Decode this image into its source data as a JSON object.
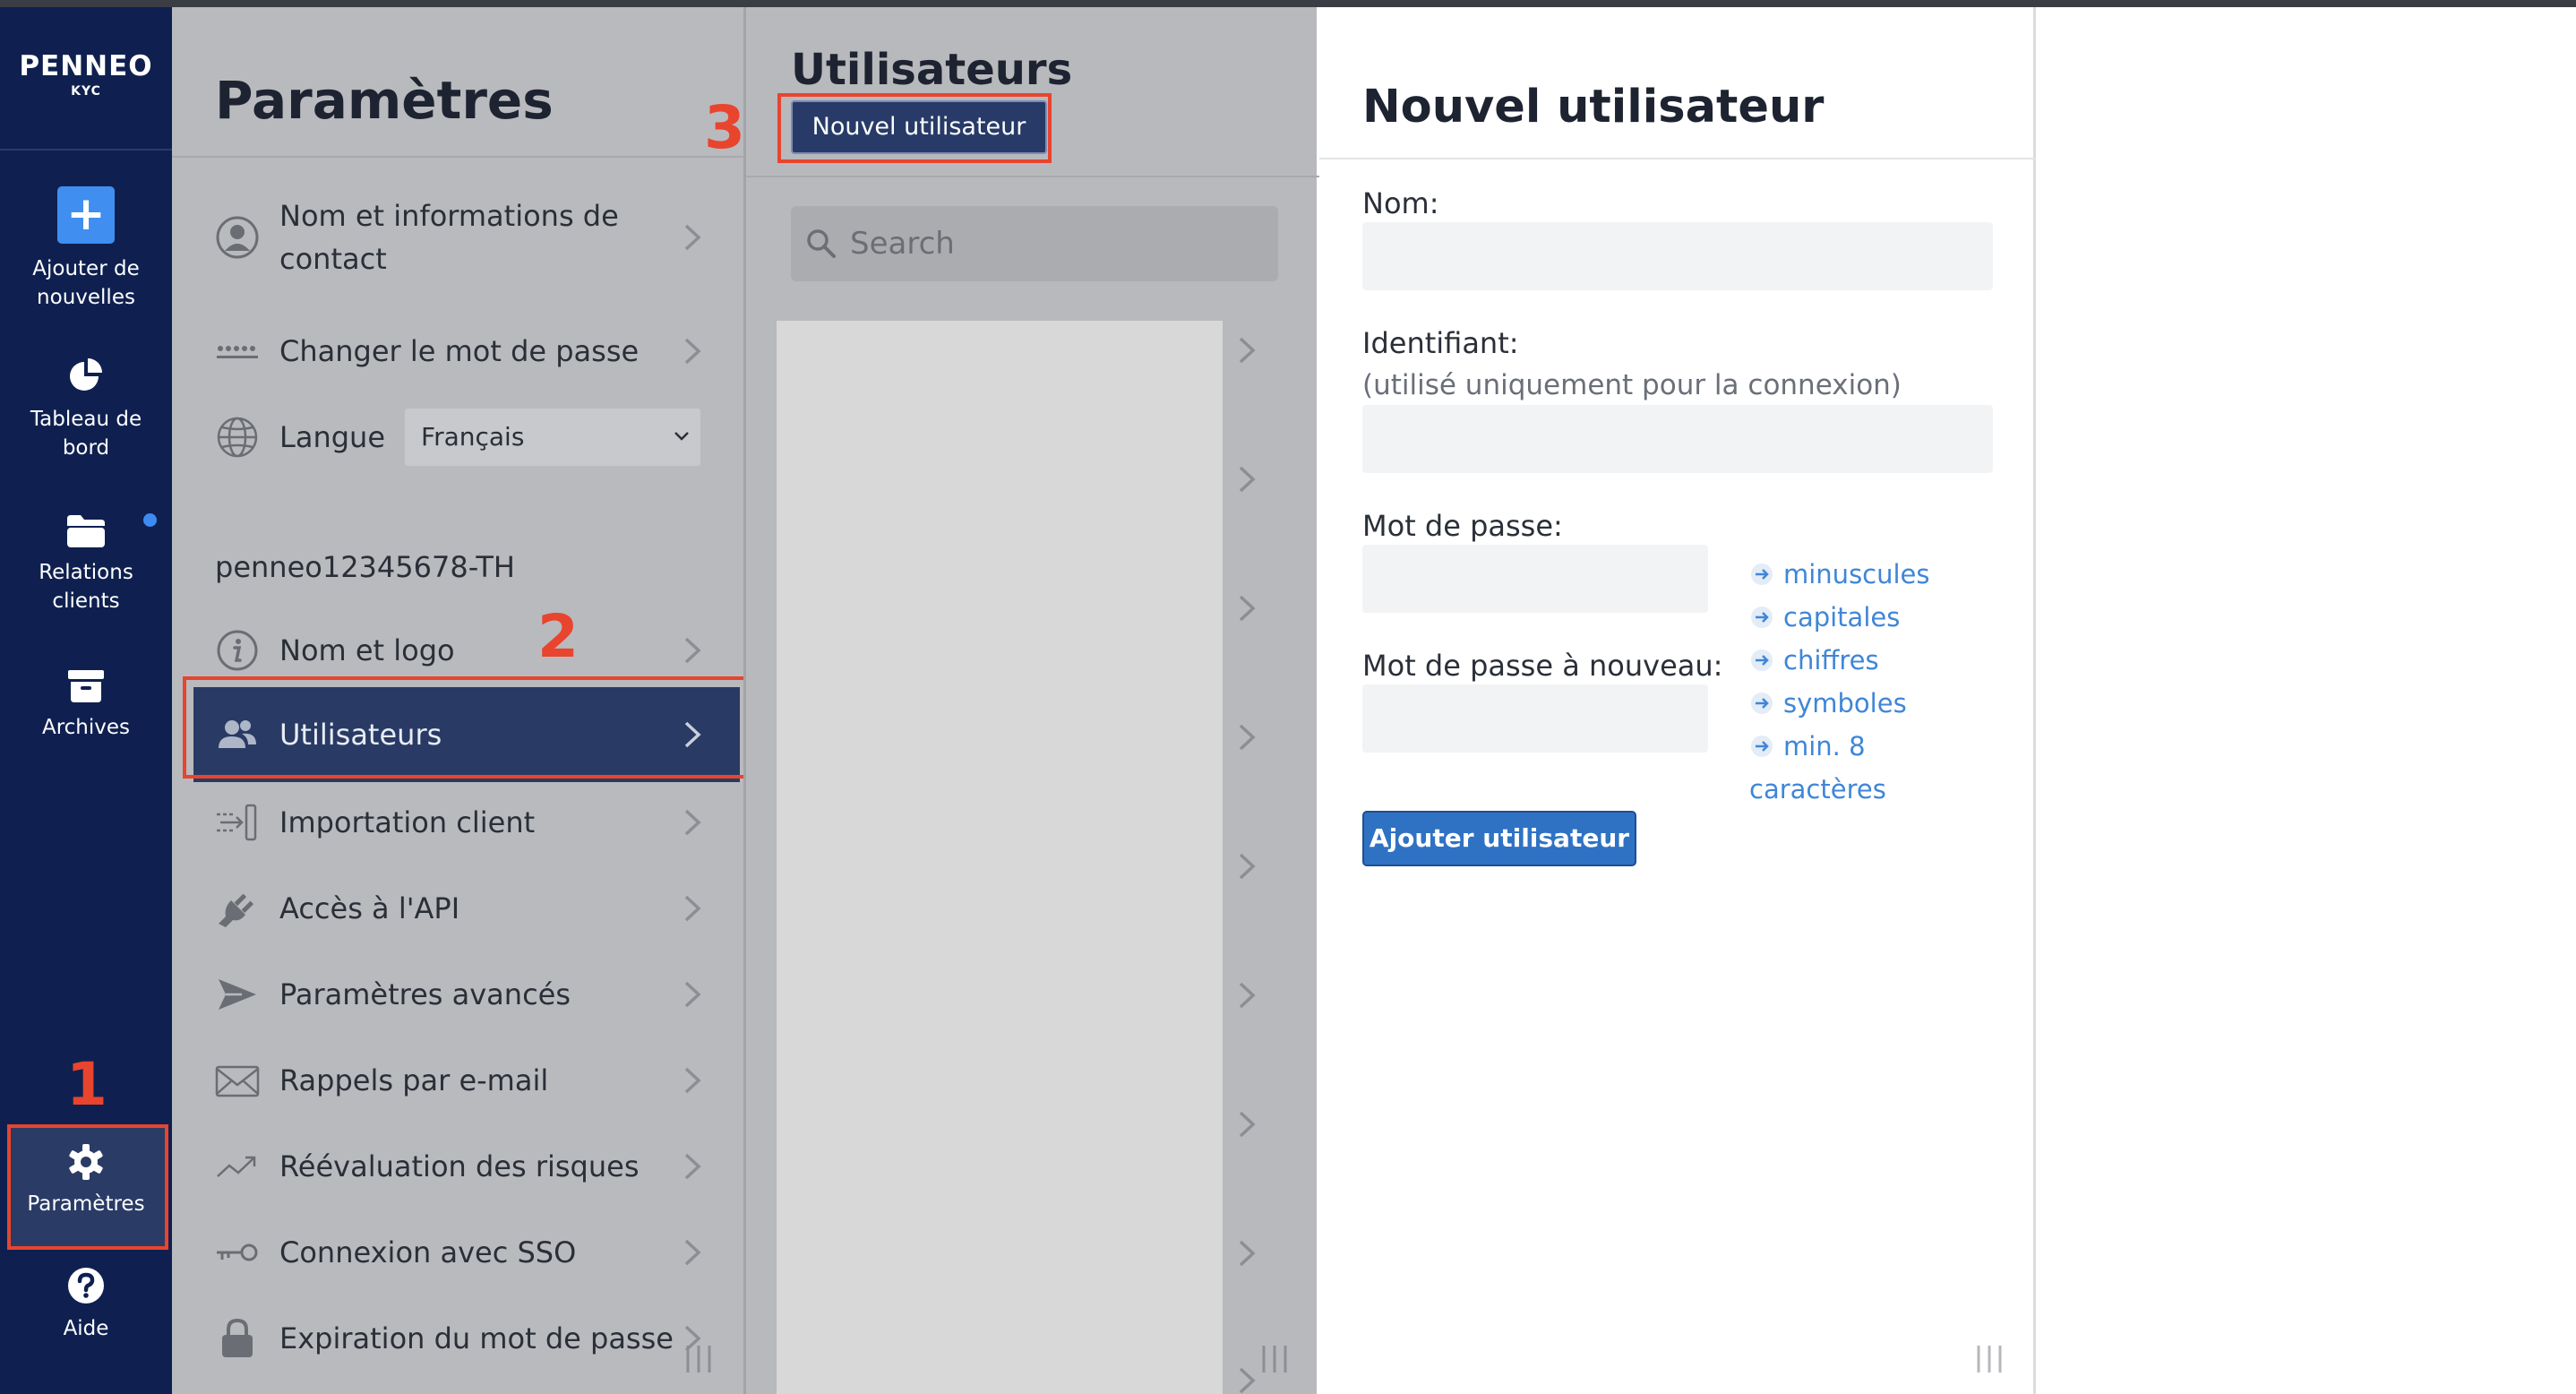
{
  "brand": {
    "logo": "PENNEO",
    "sub": "KYC"
  },
  "nav": {
    "add_new": "Ajouter de nouvelles",
    "dashboard": "Tableau de bord",
    "clients": "Relations clients",
    "archives": "Archives",
    "settings": "Paramètres",
    "help": "Aide"
  },
  "annotations": {
    "step1": "1",
    "step2": "2",
    "step3": "3"
  },
  "settings": {
    "title": "Paramètres",
    "personal_items": [
      {
        "label": "Nom et informations de contact",
        "icon": "user-circle-icon"
      },
      {
        "label": "Changer le mot de passe",
        "icon": "password-dots-icon"
      }
    ],
    "language_label": "Langue",
    "language_value": "Français",
    "org_name": "penneo12345678-TH",
    "org_items": [
      {
        "label": "Nom et logo",
        "icon": "info-icon"
      },
      {
        "label": "Utilisateurs",
        "icon": "users-icon",
        "active": true
      },
      {
        "label": "Importation client",
        "icon": "import-icon"
      },
      {
        "label": "Accès à l'API",
        "icon": "plug-icon"
      },
      {
        "label": "Paramètres avancés",
        "icon": "send-icon"
      },
      {
        "label": "Rappels par e-mail",
        "icon": "envelope-icon"
      },
      {
        "label": "Réévaluation des risques",
        "icon": "trend-icon"
      },
      {
        "label": "Connexion avec SSO",
        "icon": "key-icon"
      },
      {
        "label": "Expiration du mot de passe",
        "icon": "lock-icon"
      }
    ]
  },
  "users": {
    "title": "Utilisateurs",
    "new_button": "Nouvel utilisateur",
    "search_placeholder": "Search"
  },
  "form": {
    "title": "Nouvel utilisateur",
    "name_label": "Nom:",
    "name_value": "",
    "id_label": "Identifiant:",
    "id_hint": "(utilisé uniquement pour la connexion)",
    "id_value": "",
    "password_label": "Mot de passe:",
    "password_repeat_label": "Mot de passe à nouveau:",
    "rules": [
      "minuscules",
      "capitales",
      "chiffres",
      "symboles",
      "min. 8",
      "caractères"
    ],
    "submit": "Ajouter utilisateur"
  },
  "colors": {
    "nav_bg": "#0f2050",
    "accent_red": "#e8442e",
    "active_item": "#293b64",
    "link_blue": "#3f86d8",
    "primary_button": "#2f72c4"
  }
}
